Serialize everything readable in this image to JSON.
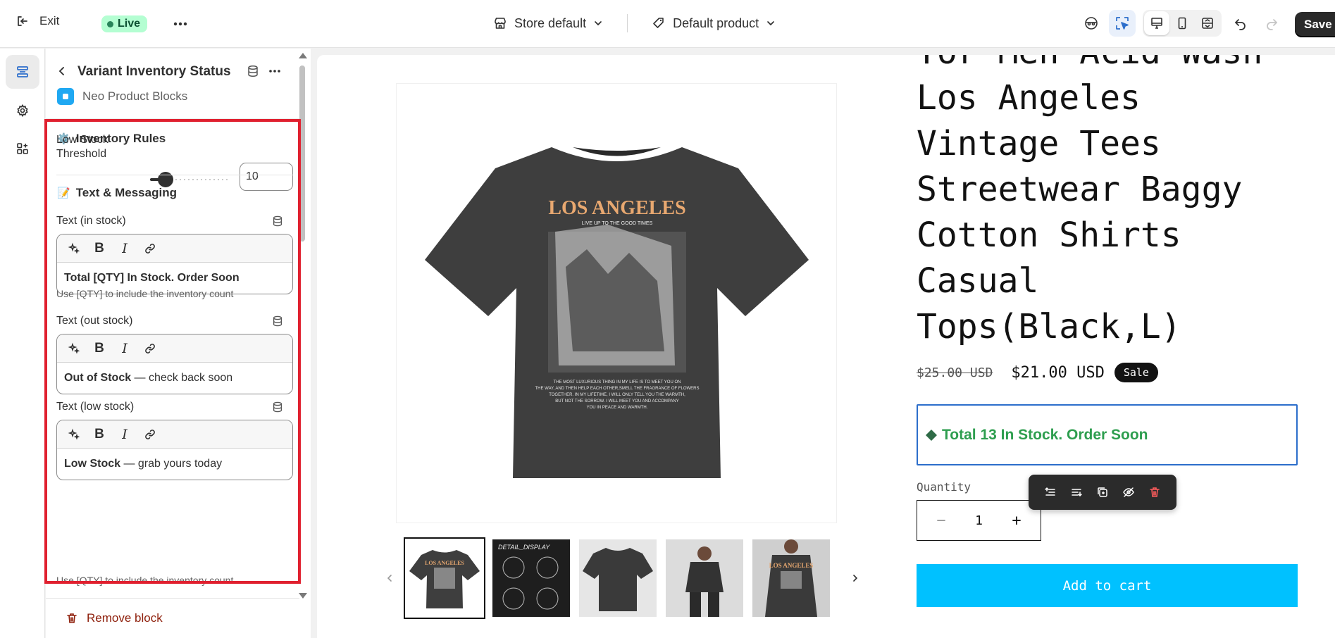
{
  "topbar": {
    "exit_label": "Exit",
    "live_label": "Live",
    "theme_label": "Store default",
    "template_label": "Default product",
    "save_label": "Save"
  },
  "panel": {
    "title": "Variant Inventory Status",
    "app_name": "Neo Product Blocks",
    "inventory_section": {
      "emoji": "⚙️",
      "heading": "Inventory Rules",
      "threshold_label": "Low Stock Threshold",
      "threshold_value": "10",
      "slider_level_fraction": 0.1
    },
    "text_section": {
      "emoji": "📝",
      "heading": "Text & Messaging",
      "fields": [
        {
          "label": "Text (in stock)",
          "strong": "Total [QTY] In Stock. Order Soon",
          "rest": "",
          "help": "Use [QTY] to include the inventory count"
        },
        {
          "label": "Text (out stock)",
          "strong": "Out of Stock",
          "rest": " — check back soon",
          "help": ""
        },
        {
          "label": "Text (low stock)",
          "strong": "Low Stock",
          "rest": " — grab yours today",
          "help": "Use [QTY] to include the inventory count"
        }
      ]
    },
    "remove_label": "Remove block"
  },
  "preview": {
    "title": "Tor Men Acid Wash\nLos Angeles\nVintage Tees\nStreetwear Baggy\nCotton Shirts\nCasual\nTops(Black,L)",
    "shirt_print_title": "LOS ANGELES",
    "shirt_print_sub": "LIVE UP TO THE GOOD TIMES",
    "shirt_print_body": [
      "THE MOST LUXURIOUS THING IN MY LIFE IS TO MEET YOU ON",
      "THE WAY, AND THEN HELP EACH OTHER,SMELL THE FRAGRANCE OF FLOWERS",
      "TOGETHER. IN MY LIFETIME, I WILL ONLY TELL YOU THE WARMTH,",
      "BUT NOT THE SORROW. I WILL MEET YOU AND ACCOMPANY",
      "YOU IN PEACE AND WARMTH."
    ],
    "thumb2_label": "DETAIL_DISPLAY",
    "price_old": "$25.00 USD",
    "price_new": "$21.00 USD",
    "sale_badge": "Sale",
    "stock_message": "Total 13 In Stock. Order Soon",
    "quantity_label": "Quantity",
    "quantity_value": "1",
    "add_to_cart": "Add to cart"
  },
  "colors": {
    "highlight": "#e0202f",
    "stock_green": "#2e9e4f",
    "cart_button": "#00c1ff",
    "selection_blue": "#2c6ecb"
  }
}
